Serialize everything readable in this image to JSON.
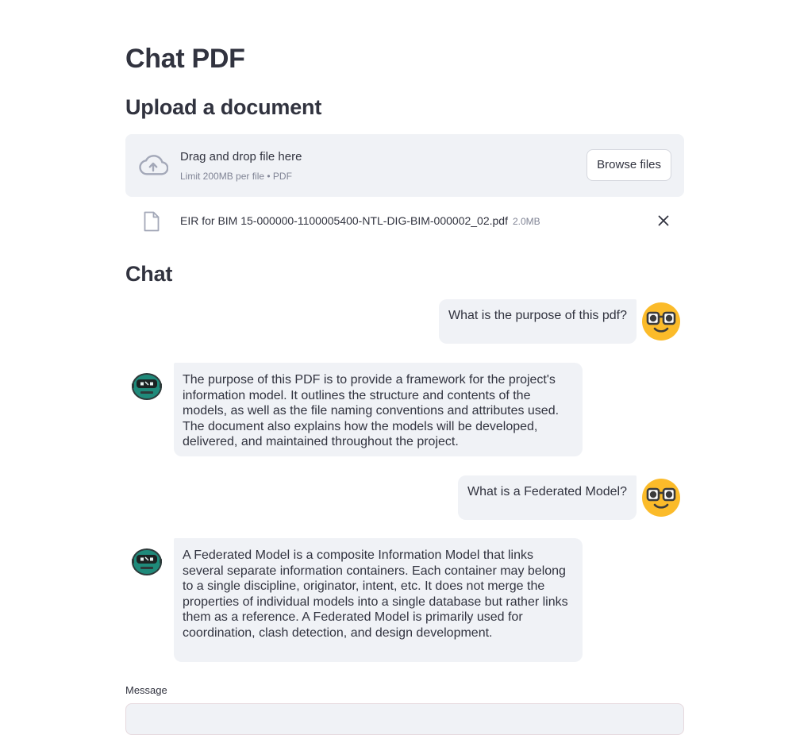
{
  "page": {
    "title": "Chat PDF",
    "upload_heading": "Upload a document",
    "chat_heading": "Chat"
  },
  "uploader": {
    "drop_text": "Drag and drop file here",
    "limit_text": "Limit 200MB per file • PDF",
    "browse_label": "Browse files",
    "icon": "cloud-upload-icon",
    "file": {
      "name": "EIR for BIM 15-000000-1100005400-NTL-DIG-BIM-000002_02.pdf",
      "size": "2.0MB",
      "icon": "file-icon",
      "remove_icon": "close-icon"
    }
  },
  "chat": {
    "messages": [
      {
        "role": "user",
        "text": "What is the purpose of this pdf?",
        "avatar": "nerd-face-emoji-icon"
      },
      {
        "role": "assistant",
        "text": "The purpose of this PDF is to provide a framework for the project's information model. It outlines the structure and contents of the models, as well as the file naming conventions and attributes used. The document also explains how the models will be developed, delivered, and maintained throughout the project.",
        "avatar": "robot-avatar-icon"
      },
      {
        "role": "user",
        "text": "What is a Federated Model?",
        "avatar": "nerd-face-emoji-icon"
      },
      {
        "role": "assistant",
        "text": "A Federated Model is a composite Information Model that links several separate information containers. Each container may belong to a single discipline, originator, intent, etc. It does not merge the properties of individual models into a single database but rather links them as a reference. A Federated Model is primarily used for coordination, clash detection, and design development.",
        "avatar": "robot-avatar-icon"
      }
    ]
  },
  "input": {
    "label": "Message",
    "value": ""
  },
  "colors": {
    "bubble_bg": "#f0f2f6",
    "text": "#31333f",
    "muted": "#808495",
    "emoji_yellow": "#fbbb2a",
    "robot_teal": "#1f8a7a"
  }
}
